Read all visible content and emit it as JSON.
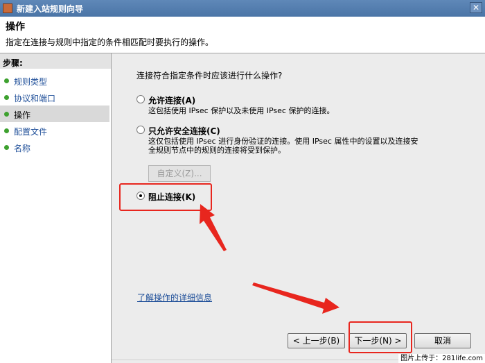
{
  "window": {
    "title": "新建入站规则向导",
    "close_glyph": "✕"
  },
  "header": {
    "title": "操作",
    "description": "指定在连接与规则中指定的条件相匹配时要执行的操作。"
  },
  "sidebar": {
    "steps_label": "步骤:",
    "items": [
      {
        "label": "规则类型",
        "active": false
      },
      {
        "label": "协议和端口",
        "active": false
      },
      {
        "label": "操作",
        "active": true
      },
      {
        "label": "配置文件",
        "active": false
      },
      {
        "label": "名称",
        "active": false
      }
    ]
  },
  "main": {
    "question": "连接符合指定条件时应该进行什么操作?",
    "options": [
      {
        "label": "允许连接(A)",
        "description": "这包括使用 IPsec 保护以及未使用 IPsec 保护的连接。",
        "selected": false
      },
      {
        "label": "只允许安全连接(C)",
        "description_line1": "这仅包括使用 IPsec 进行身份验证的连接。使用 IPsec 属性中的设置以及连接安",
        "description_line2": "全规则节点中的规则的连接将受到保护。",
        "selected": false
      },
      {
        "label": "阻止连接(K)",
        "selected": true
      }
    ],
    "customize_button": "自定义(Z)...",
    "learn_more_link": "了解操作的详细信息"
  },
  "buttons": {
    "back": "< 上一步(B)",
    "next": "下一步(N) >",
    "cancel": "取消"
  },
  "watermark": "图片上传于：281life.com",
  "colors": {
    "annotation": "#e8261e",
    "titlebar": "#4a74a6",
    "link": "#1f4f99"
  }
}
